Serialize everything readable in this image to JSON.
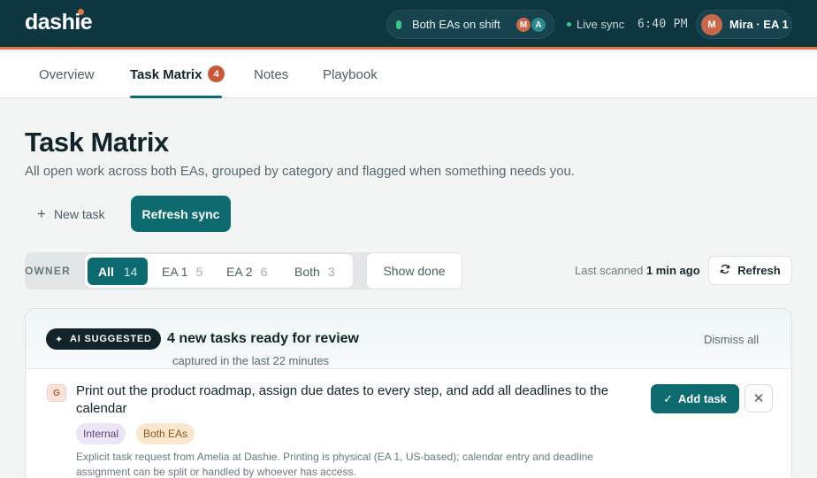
{
  "app": {
    "logo": "dashie"
  },
  "topbar": {
    "shift_status": "Both EAs on shift",
    "shift_avatars": [
      {
        "initial": "M",
        "color": "#c9684a"
      },
      {
        "initial": "A",
        "color": "#2f8a8e"
      }
    ],
    "sync_status": "Live sync",
    "clock": "6:40 PM",
    "user": {
      "initial": "M",
      "label": "Mira · EA 1"
    }
  },
  "tabs": [
    {
      "label": "Overview",
      "active": false
    },
    {
      "label": "Task Matrix",
      "active": true,
      "badge": "4"
    },
    {
      "label": "Notes",
      "active": false
    },
    {
      "label": "Playbook",
      "active": false
    }
  ],
  "page": {
    "title": "Task Matrix",
    "subtitle": "All open work across both EAs, grouped by category and flagged when something needs you.",
    "new_task_label": "New task",
    "refresh_sync_label": "Refresh sync"
  },
  "filters": {
    "owner_label": "OWNER",
    "options": [
      {
        "label": "All",
        "count": "14",
        "active": true
      },
      {
        "label": "EA 1",
        "count": "5",
        "active": false
      },
      {
        "label": "EA 2",
        "count": "6",
        "active": false
      },
      {
        "label": "Both",
        "count": "3",
        "active": false
      }
    ],
    "show_done_label": "Show done",
    "last_scanned_prefix": "Last scanned",
    "last_scanned_value": "1 min ago",
    "refresh_label": "Refresh"
  },
  "suggestions": {
    "badge": "AI SUGGESTED",
    "title": "4 new tasks ready for review",
    "subtitle": "captured in the last 22 minutes",
    "dismiss_all_label": "Dismiss all",
    "items": [
      {
        "category_letter": "G",
        "title": "Print out the product roadmap, assign due dates to every step, and add all deadlines to the calendar",
        "tags": [
          "Internal",
          "Both EAs"
        ],
        "description": "Explicit task request from Amelia at Dashie. Printing is physical (EA 1, US-based); calendar entry and deadline assignment can be split or handled by whoever has access.",
        "add_label": "Add task",
        "dismiss_symbol": "✕"
      }
    ]
  },
  "colors": {
    "brand_dark": "#0e3640",
    "accent_teal": "#0d6a6e",
    "accent_orange": "#e1793f",
    "badge_red": "#c9573a",
    "status_green": "#36c98a"
  },
  "icons": [
    "plus-icon",
    "sparkle-icon",
    "refresh-icon",
    "check-icon",
    "close-icon",
    "status-dot-icon"
  ]
}
